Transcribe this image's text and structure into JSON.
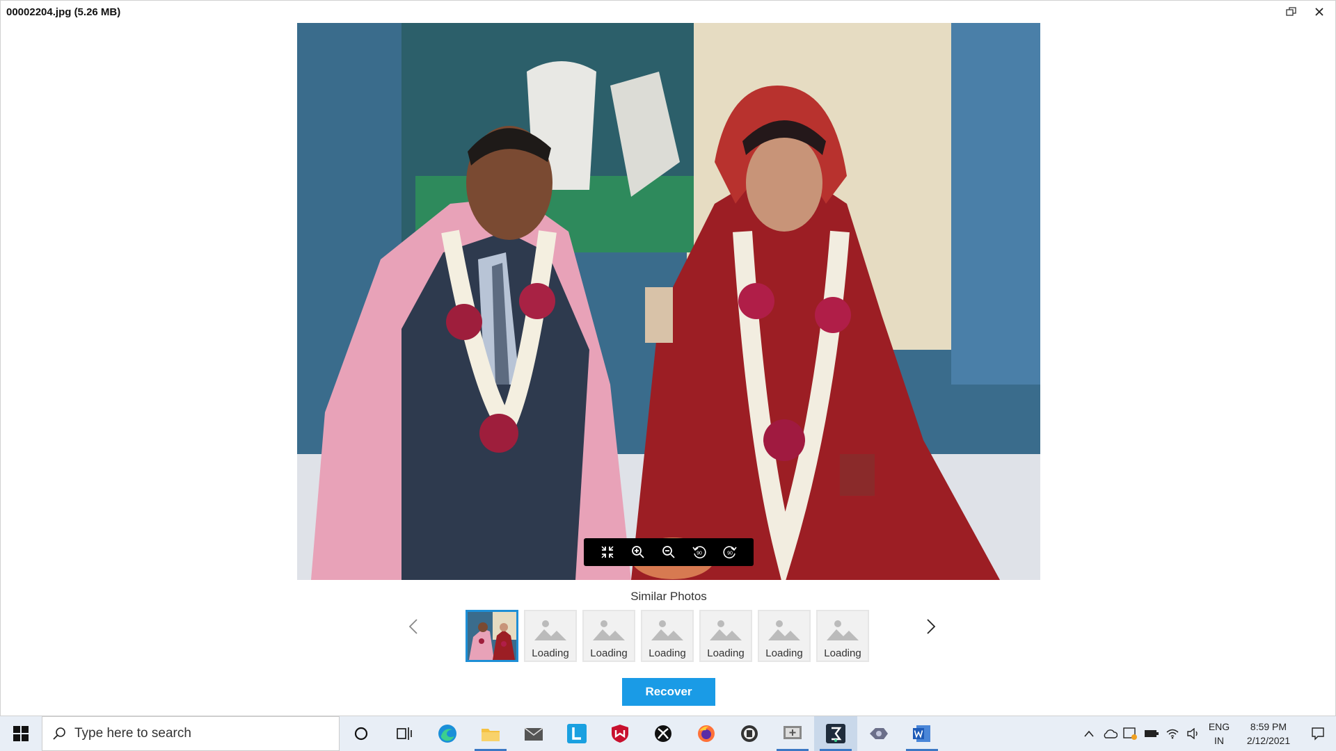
{
  "window": {
    "title": "00002204.jpg (5.26 MB)"
  },
  "viewer_toolbar": {
    "buttons": [
      {
        "name": "exit-fullscreen-icon"
      },
      {
        "name": "zoom-in-icon"
      },
      {
        "name": "zoom-out-icon"
      },
      {
        "name": "rotate-left-90-icon"
      },
      {
        "name": "rotate-right-90-icon"
      }
    ],
    "rotate_left_text": "90",
    "rotate_right_text": "90"
  },
  "similar": {
    "label": "Similar Photos",
    "thumbnails": [
      {
        "caption": "",
        "selected": true
      },
      {
        "caption": "Loading"
      },
      {
        "caption": "Loading"
      },
      {
        "caption": "Loading"
      },
      {
        "caption": "Loading"
      },
      {
        "caption": "Loading"
      },
      {
        "caption": "Loading"
      }
    ]
  },
  "recover_label": "Recover",
  "taskbar": {
    "search_placeholder": "Type here to search",
    "apps": [
      "cortana-icon",
      "task-view-icon",
      "edge-icon",
      "file-explorer-icon",
      "mail-icon",
      "l-app-icon",
      "mcafee-icon",
      "xbox-icon",
      "firefox-icon",
      "app-gear-icon",
      "screen-app-icon",
      "recovery-app-icon",
      "game-app-icon",
      "word-icon"
    ],
    "lang_line1": "ENG",
    "lang_line2": "IN",
    "time": "8:59 PM",
    "date": "2/12/2021"
  },
  "colors": {
    "accent": "#1a9be6",
    "selected_border": "#1e8fd6",
    "taskbar_bg": "#e8eef6"
  }
}
